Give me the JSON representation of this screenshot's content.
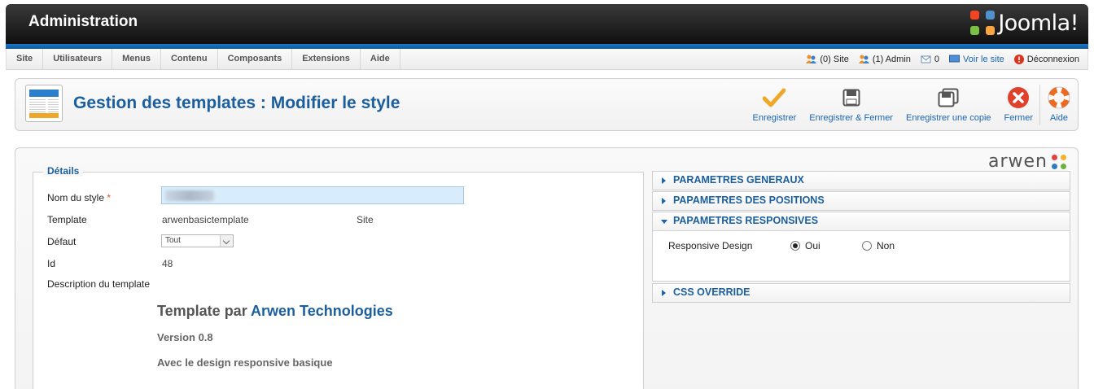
{
  "header": {
    "title": "Administration",
    "logo_text": "Joomla!"
  },
  "menu": {
    "items": [
      "Site",
      "Utilisateurs",
      "Menus",
      "Contenu",
      "Composants",
      "Extensions",
      "Aide"
    ]
  },
  "status": {
    "site_visitors": "(0) Site",
    "admin_visitors": "(1) Admin",
    "messages": "0",
    "view_site": "Voir le site",
    "logout": "Déconnexion"
  },
  "toolbar": {
    "page_title": "Gestion des templates : Modifier le style",
    "save": "Enregistrer",
    "save_close": "Enregistrer & Fermer",
    "save_copy": "Enregistrer une copie",
    "close": "Fermer",
    "help": "Aide"
  },
  "brand": {
    "text": "arwen"
  },
  "details": {
    "legend": "Détails",
    "style_name_label": "Nom du style",
    "required_mark": "*",
    "template_label": "Template",
    "template_value": "arwenbasictemplate",
    "template_client": "Site",
    "default_label": "Défaut",
    "default_value": "Tout",
    "id_label": "Id",
    "id_value": "48",
    "description_label": "Description du template",
    "tpl_title_prefix": "Template par ",
    "tpl_title_brand": "Arwen Technologies",
    "tpl_version": "Version 0.8",
    "tpl_desc": "Avec le design responsive basique"
  },
  "params": {
    "general": "PARAMETRES GENERAUX",
    "positions": "PAPAMETRES DES POSITIONS",
    "responsive": "PAPAMETRES RESPONSIVES",
    "responsive_design_label": "Responsive Design",
    "option_yes": "Oui",
    "option_no": "Non",
    "selected": "Oui",
    "css_override": "CSS OVERRIDE"
  },
  "colors": {
    "accent": "#1b5f9e",
    "link": "#1b65b0",
    "save_check": "#f0a728",
    "close_red": "#e0412a",
    "help_orange": "#ee6a1f"
  },
  "icons": {
    "template_manager": "template-manager-icon",
    "save": "checkmark-icon",
    "save_close": "floppy-icon",
    "save_copy": "floppy-copy-icon",
    "close": "close-circle-icon",
    "help": "lifebuoy-icon"
  }
}
